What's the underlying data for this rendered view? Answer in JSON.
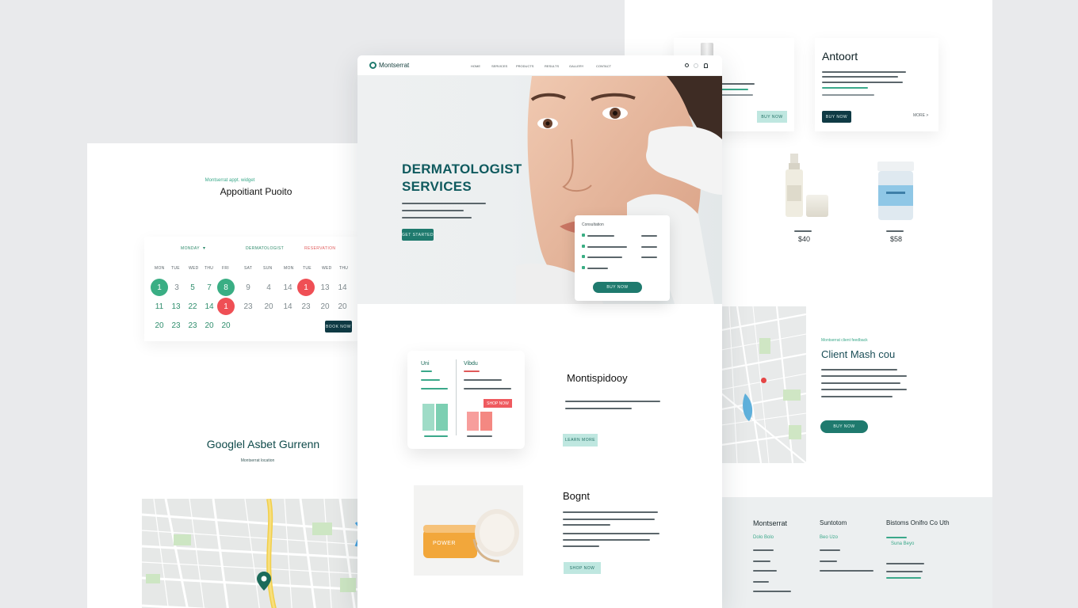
{
  "center": {
    "brand": "Montserrat",
    "nav": [
      "HOME",
      "SERVICES",
      "PRODUCTS",
      "RESULTS",
      "GALLERY",
      "CONTACT"
    ],
    "hero_title_1": "DERMATOLOGIST",
    "hero_title_2": "SERVICES",
    "hero_button": "GET STARTED",
    "card_label": "Consultation",
    "card_button": "BUY NOW",
    "section1_title": "Montispidooy",
    "section1_button": "LEARN MORE",
    "chart_left_label": "Uni",
    "chart_right_label": "Vibdu",
    "chart_badge": "SHOP NOW",
    "section2_title": "Bognt",
    "section2_button": "SHOP NOW",
    "jar_label": "POWER"
  },
  "left": {
    "appointment_kicker": "Montserrat appt. widget",
    "appointment_title": "Appoitiant Puoito",
    "tab_left": "MONDAY",
    "tab_middle": "DERMATOLOGIST",
    "tab_right": "RESERVATION",
    "weekdays": [
      "MON",
      "TUE",
      "WED",
      "THU",
      "FRI",
      "SAT",
      "SUN",
      "MON",
      "TUE",
      "WED",
      "THU"
    ],
    "row1": [
      "1",
      "3",
      "5",
      "7",
      "8",
      "9",
      "4",
      "14",
      "1",
      "13",
      "14"
    ],
    "row2": [
      "11",
      "13",
      "22",
      "14",
      "1",
      "23",
      "20",
      "14",
      "23",
      "20",
      "20"
    ],
    "row3": [
      "20",
      "23",
      "23",
      "20",
      "20"
    ],
    "calendar_button": "BOOK NOW",
    "map_title": "Googlel Asbet Gurrenn",
    "map_sub": "Montserrat location"
  },
  "right": {
    "about_title": "Antoort",
    "about_button": "BUY NOW",
    "about_link": "MORE >",
    "promo_button": "BUY NOW",
    "price_1": "$40",
    "price_2": "$58",
    "client_kicker": "Montserrat client feedback",
    "client_title": "Client Mash cou",
    "client_button": "BUY NOW",
    "footer_brand": "Montserrat",
    "footer_col2": "Suntotom",
    "footer_col3": "Bistoms Onifro Co Uth",
    "footer_link_1": "Dolo Bolo",
    "footer_link_2": "Beo Uzo",
    "footer_link_3": "Suna Beyo"
  }
}
